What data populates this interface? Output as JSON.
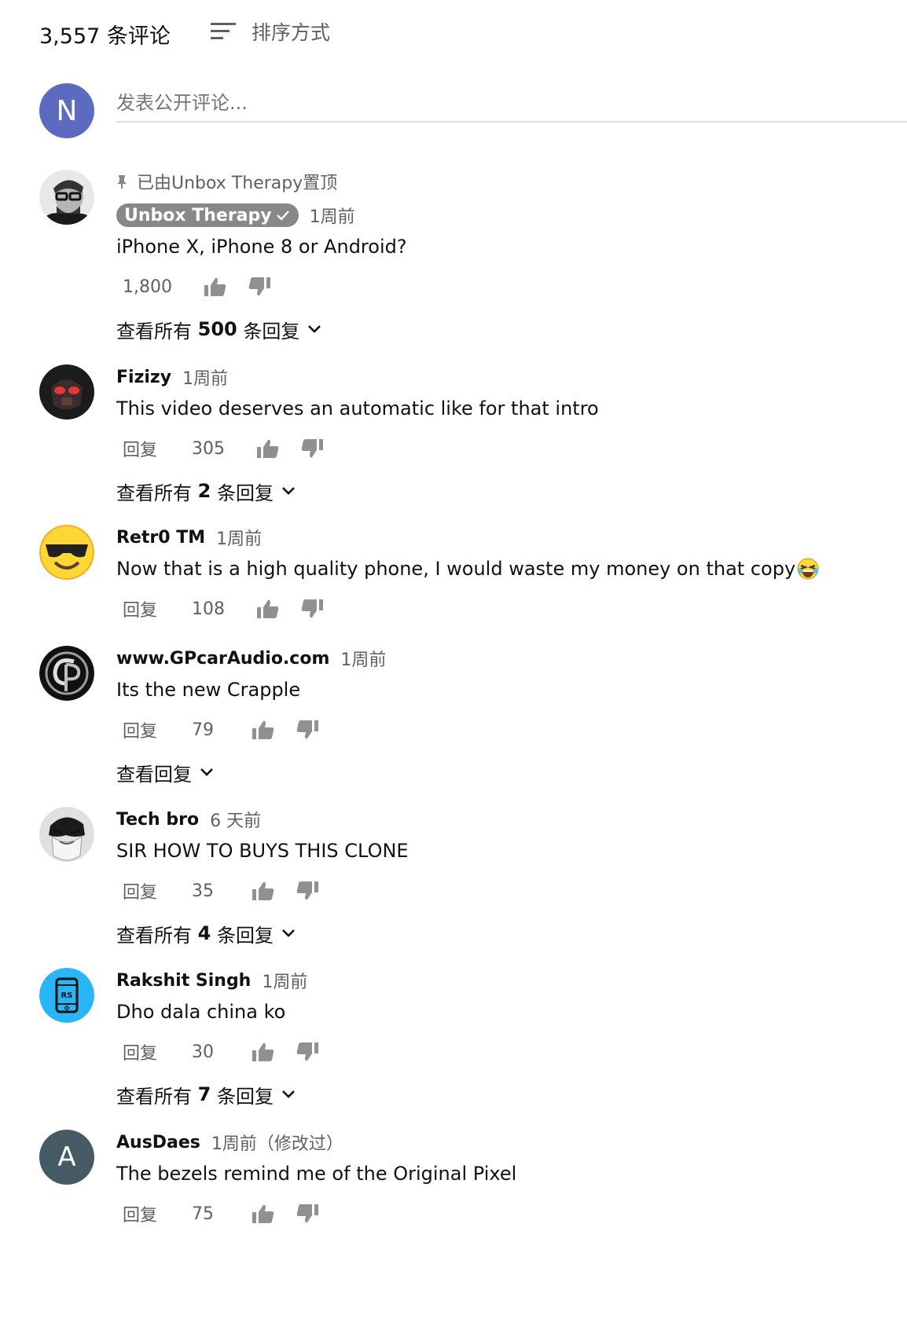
{
  "header": {
    "comment_count": "3,557 条评论",
    "sort_label": "排序方式"
  },
  "new_comment": {
    "avatar_letter": "N",
    "placeholder": "发表公开评论..."
  },
  "colors": {
    "owner_badge": "#888888",
    "new_avatar": "#5c6bc0",
    "avatar_a": "#455a64",
    "avatar_rs": "#29b6f6"
  },
  "comments": [
    {
      "pinned_text": "已由Unbox Therapy置顶",
      "author": "Unbox Therapy",
      "time": "1周前",
      "text": "iPhone X, iPhone 8 or Android?",
      "likes": "1,800",
      "view_prefix": "查看所有 ",
      "view_count": "500",
      "view_suffix": " 条回复"
    },
    {
      "author": "Fizizy",
      "time": "1周前",
      "text": "This video deserves an automatic like for that intro",
      "reply": "回复",
      "likes": "305",
      "view_prefix": "查看所有 ",
      "view_count": "2",
      "view_suffix": " 条回复"
    },
    {
      "author": "Retr0 TM",
      "time": "1周前",
      "text": "Now that is a high quality phone, I would waste my money on that copy",
      "reply": "回复",
      "likes": "108"
    },
    {
      "author": "www.GPcarAudio.com",
      "time": "1周前",
      "text": "Its the new Crapple",
      "reply": "回复",
      "likes": "79",
      "view_label": "查看回复"
    },
    {
      "author": "Tech bro",
      "time": "6 天前",
      "text": "SIR HOW TO BUYS THIS CLONE",
      "reply": "回复",
      "likes": "35",
      "view_prefix": "查看所有 ",
      "view_count": "4",
      "view_suffix": " 条回复"
    },
    {
      "author": "Rakshit Singh",
      "time": "1周前",
      "text": "Dho dala china ko",
      "reply": "回复",
      "likes": "30",
      "view_prefix": "查看所有 ",
      "view_count": "7",
      "view_suffix": " 条回复",
      "avatar_text": "RS"
    },
    {
      "author": "AusDaes",
      "time": "1周前（修改过）",
      "text": "The bezels remind me of the Original Pixel",
      "reply": "回复",
      "likes": "75",
      "avatar_letter": "A"
    }
  ],
  "icons": {
    "sort": "sort-icon",
    "thumb_up": "thumb-up-icon",
    "thumb_down": "thumb-down-icon",
    "chevron": "chevron-down-icon",
    "pin": "pin-icon",
    "verified": "check-icon",
    "emoji": "laughing-emoji-icon"
  }
}
